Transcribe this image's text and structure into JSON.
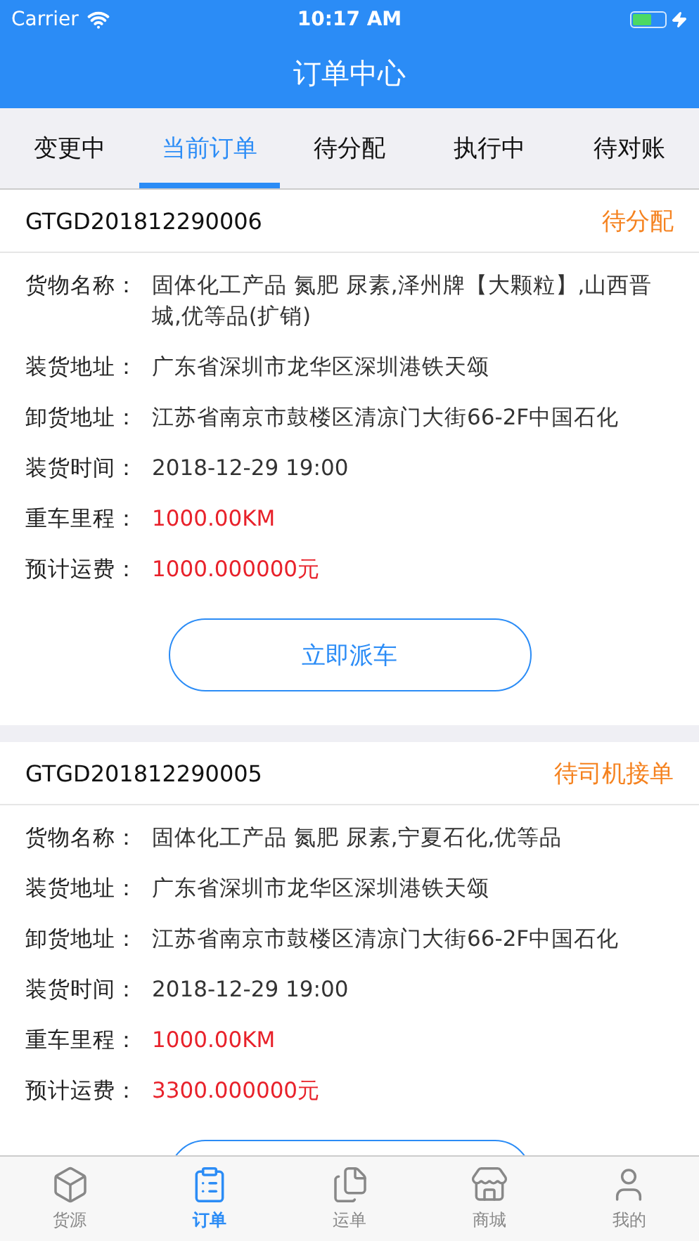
{
  "status_bar": {
    "carrier": "Carrier",
    "time": "10:17 AM"
  },
  "nav": {
    "title": "订单中心"
  },
  "tabs": [
    {
      "label": "变更中",
      "selected": false
    },
    {
      "label": "当前订单",
      "selected": true
    },
    {
      "label": "待分配",
      "selected": false
    },
    {
      "label": "执行中",
      "selected": false
    },
    {
      "label": "待对账",
      "selected": false
    }
  ],
  "orders": [
    {
      "number": "GTGD201812290006",
      "status": "待分配",
      "fields": [
        {
          "label": "货物名称：",
          "value": "固体化工产品 氮肥 尿素,泽州牌【大颗粒】,山西晋城,优等品(扩销)",
          "highlight": false
        },
        {
          "label": "装货地址：",
          "value": "广东省深圳市龙华区深圳港铁天颂",
          "highlight": false
        },
        {
          "label": "卸货地址：",
          "value": "江苏省南京市鼓楼区清凉门大街66-2F中国石化",
          "highlight": false
        },
        {
          "label": "装货时间：",
          "value": "2018-12-29 19:00",
          "highlight": false
        },
        {
          "label": "重车里程：",
          "value": "1000.00KM",
          "highlight": true
        },
        {
          "label": "预计运费：",
          "value": "1000.000000元",
          "highlight": true
        }
      ],
      "button": {
        "label": "立即派车"
      }
    },
    {
      "number": "GTGD201812290005",
      "status": "待司机接单",
      "fields": [
        {
          "label": "货物名称：",
          "value": "固体化工产品 氮肥 尿素,宁夏石化,优等品",
          "highlight": false
        },
        {
          "label": "装货地址：",
          "value": "广东省深圳市龙华区深圳港铁天颂",
          "highlight": false
        },
        {
          "label": "卸货地址：",
          "value": "江苏省南京市鼓楼区清凉门大街66-2F中国石化",
          "highlight": false
        },
        {
          "label": "装货时间：",
          "value": "2018-12-29 19:00",
          "highlight": false
        },
        {
          "label": "重车里程：",
          "value": "1000.00KM",
          "highlight": true
        },
        {
          "label": "预计运费：",
          "value": "3300.000000元",
          "highlight": true
        }
      ],
      "button": {
        "label_hidden": true
      }
    }
  ],
  "bottom_tabs": [
    {
      "kind": "box",
      "label": "货源",
      "selected": false
    },
    {
      "kind": "clipboard",
      "label": "订单",
      "selected": true
    },
    {
      "kind": "document",
      "label": "运单",
      "selected": false
    },
    {
      "kind": "store",
      "label": "商城",
      "selected": false
    },
    {
      "kind": "person",
      "label": "我的",
      "selected": false
    }
  ]
}
